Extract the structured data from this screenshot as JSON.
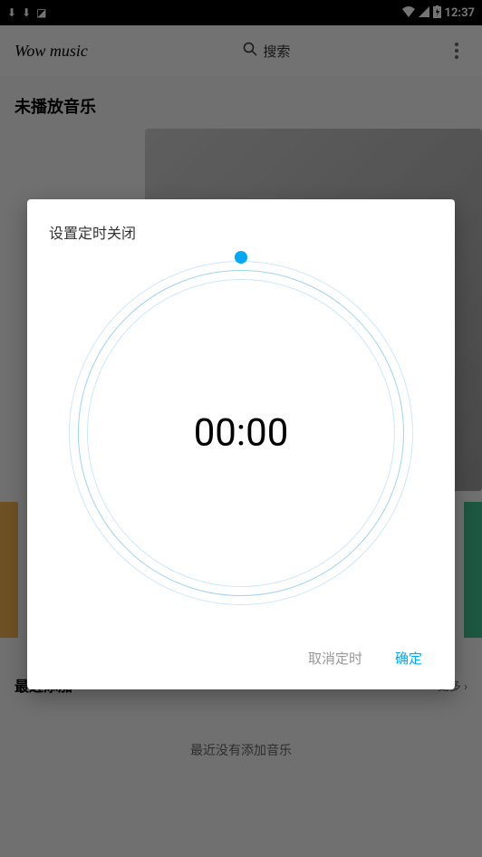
{
  "status_bar": {
    "time": "12:37"
  },
  "header": {
    "app_title": "Wow music",
    "search_label": "搜索"
  },
  "main": {
    "now_playing_heading": "未播放音乐",
    "recent_heading": "最近添加",
    "recent_more": "更多",
    "empty_message": "最近没有添加音乐"
  },
  "dialog": {
    "title": "设置定时关闭",
    "timer_value": "00:00",
    "cancel_label": "取消定时",
    "confirm_label": "确定"
  }
}
